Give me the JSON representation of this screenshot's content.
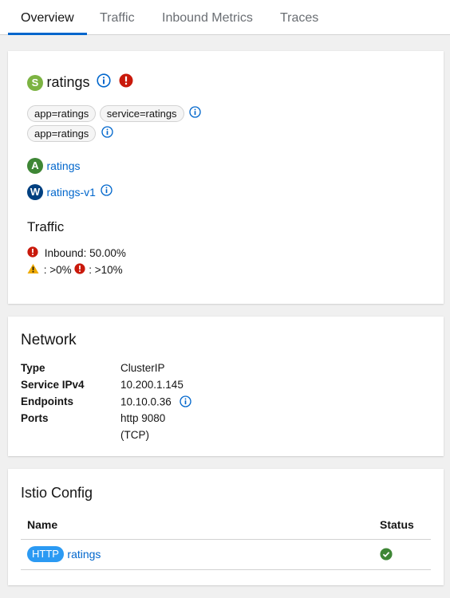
{
  "tabs": [
    {
      "label": "Overview",
      "active": true
    },
    {
      "label": "Traffic"
    },
    {
      "label": "Inbound Metrics"
    },
    {
      "label": "Traces"
    }
  ],
  "service": {
    "badge": "S",
    "name": "ratings",
    "labels_row1": [
      "app=ratings",
      "service=ratings"
    ],
    "labels_row2": [
      "app=ratings"
    ],
    "app_badge": "A",
    "app_link": "ratings",
    "workload_badge": "W",
    "workload_link": "ratings-v1"
  },
  "traffic": {
    "heading": "Traffic",
    "inbound": "Inbound: 50.00%",
    "threshold_warn": ": >0%",
    "threshold_err": ": >10%"
  },
  "network": {
    "heading": "Network",
    "rows": [
      {
        "label": "Type",
        "value": "ClusterIP"
      },
      {
        "label": "Service IPv4",
        "value": "10.200.1.145"
      },
      {
        "label": "Endpoints",
        "value": "10.10.0.36"
      },
      {
        "label": "Ports",
        "value": "http 9080",
        "value2": "(TCP)"
      }
    ]
  },
  "istio": {
    "heading": "Istio Config",
    "col_name": "Name",
    "col_status": "Status",
    "row": {
      "badge": "HTTP",
      "name": "ratings"
    }
  },
  "colors": {
    "service_badge": "#7cb342",
    "app_badge": "#3e8635",
    "workload_badge": "#004080",
    "link": "#0066cc",
    "danger": "#c9190b",
    "warning": "#f0ab00",
    "success": "#3e8635"
  }
}
